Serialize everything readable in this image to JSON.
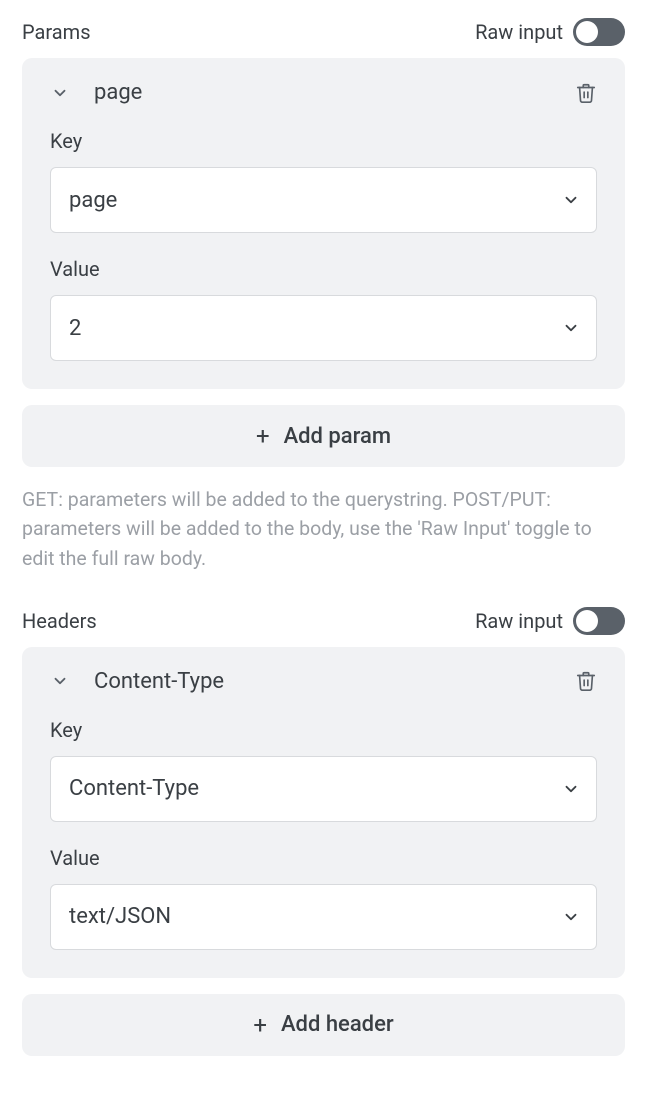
{
  "sections": {
    "params": {
      "title": "Params",
      "rawInputLabel": "Raw input",
      "items": [
        {
          "name": "page",
          "keyLabel": "Key",
          "keyValue": "page",
          "valueLabel": "Value",
          "valueValue": "2"
        }
      ],
      "addLabel": "Add param",
      "helpText": "GET: parameters will be added to the querystring. POST/PUT: parameters will be added to the body, use the 'Raw Input' toggle to edit the full raw body."
    },
    "headers": {
      "title": "Headers",
      "rawInputLabel": "Raw input",
      "items": [
        {
          "name": "Content-Type",
          "keyLabel": "Key",
          "keyValue": "Content-Type",
          "valueLabel": "Value",
          "valueValue": "text/JSON"
        }
      ],
      "addLabel": "Add header"
    }
  }
}
